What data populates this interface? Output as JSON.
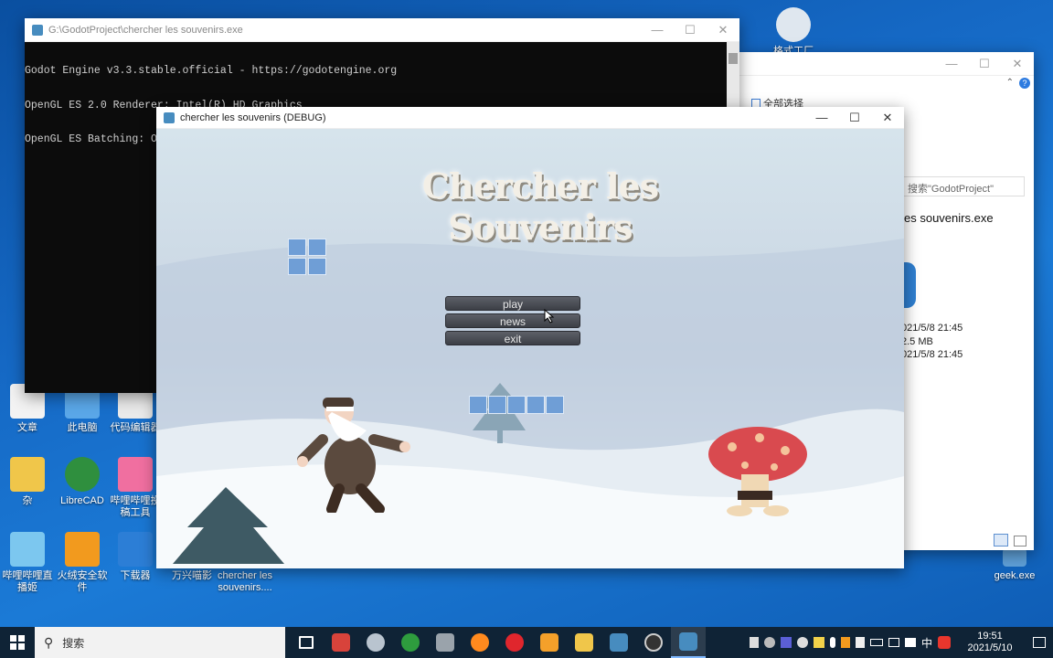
{
  "desktop": {
    "icons": [
      {
        "label": "文章"
      },
      {
        "label": "此电脑"
      },
      {
        "label": "代码编辑器"
      },
      {
        "label": "杂"
      },
      {
        "label": "LibreCAD"
      },
      {
        "label": "哔哩哔哩投稿工具"
      },
      {
        "label": "哔哩哔哩直播姬"
      },
      {
        "label": "火绒安全软件"
      },
      {
        "label": "下载器"
      },
      {
        "label": "万兴喵影"
      },
      {
        "label": "chercher les souvenirs...."
      },
      {
        "label": "格式工厂"
      },
      {
        "label": "geek.exe"
      }
    ]
  },
  "console_window": {
    "title": "G:\\GodotProject\\chercher les souvenirs.exe",
    "lines": [
      "Godot Engine v3.3.stable.official - https://godotengine.org",
      "OpenGL ES 2.0 Renderer: Intel(R) HD Graphics",
      "OpenGL ES Batching: ON"
    ]
  },
  "explorer_window": {
    "toolbar_label": "全部选择",
    "search_placeholder": "搜索\"GodotProject\"",
    "file_name": "es souvenirs.exe",
    "details": [
      "021/5/8 21:45",
      "2.5 MB",
      "021/5/8 21:45"
    ]
  },
  "game_window": {
    "title": "chercher les souvenirs (DEBUG)",
    "game_title": "Chercher les Souvenirs",
    "menu": {
      "play": "play",
      "news": "news",
      "exit": "exit"
    }
  },
  "taskbar": {
    "search_label": "搜索",
    "clock_time": "19:51",
    "clock_date": "2021/5/10",
    "ime": "中",
    "colors": {
      "bg": "#0f2336",
      "accent": "#7fb8ff"
    }
  }
}
